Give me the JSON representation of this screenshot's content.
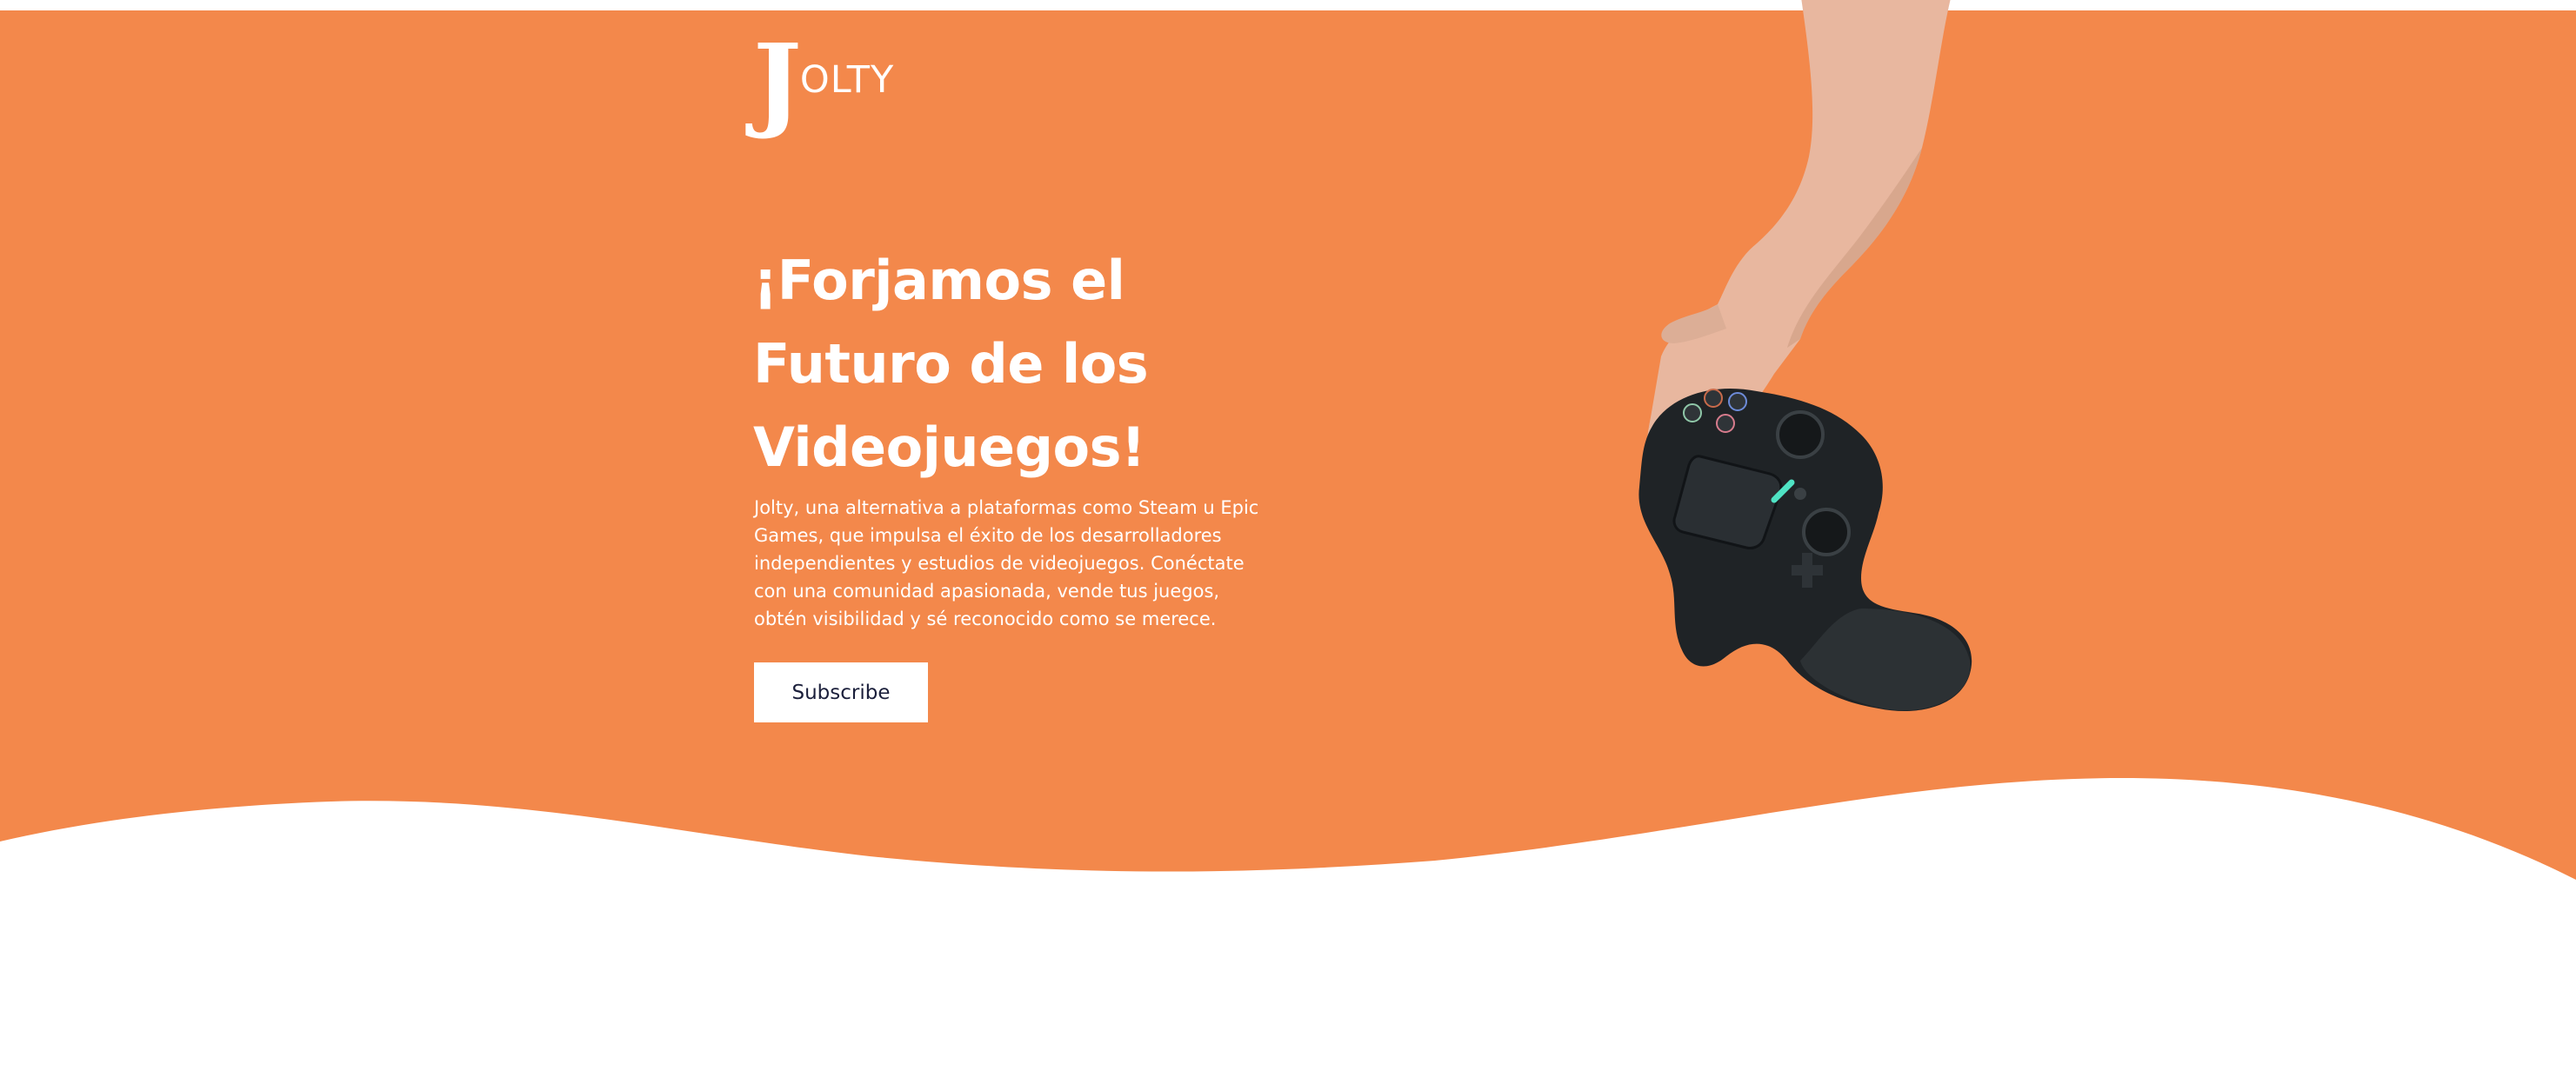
{
  "brand": {
    "logo_initial": "J",
    "logo_rest": "OLTY"
  },
  "hero": {
    "headline_lines": [
      "¡Forjamos el",
      "Futuro de los",
      "Videojuegos!"
    ],
    "description_lines": [
      "Jolty, una alternativa a plataformas como Steam u Epic",
      "Games, que impulsa el éxito de los desarrolladores",
      "independientes y estudios de videojuegos. Conéctate",
      "con una comunidad apasionada, vende tus juegos,",
      "obtén visibilidad y sé reconocido como se merece."
    ],
    "cta_label": "Subscribe"
  },
  "colors": {
    "hero_orange": "#f3884b",
    "text_white": "#ffffff",
    "button_text": "#1b1f3b"
  },
  "icons": {
    "hero_image": "hand-holding-gamepad-image",
    "logo": "jolty-logo"
  }
}
